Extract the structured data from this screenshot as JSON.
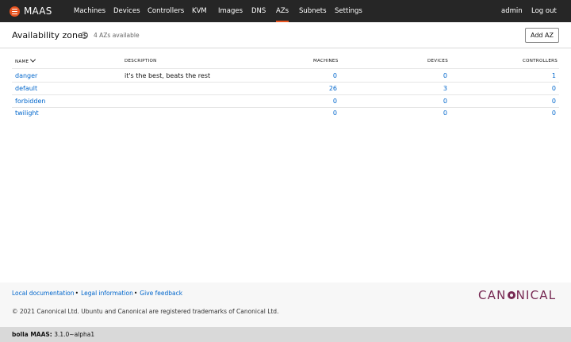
{
  "nav": {
    "logo": "MAAS",
    "items": [
      "Machines",
      "Devices",
      "Controllers",
      "KVM",
      "Images",
      "DNS",
      "AZs",
      "Subnets",
      "Settings"
    ],
    "active": "AZs",
    "user": "admin",
    "logout": "Log out"
  },
  "header": {
    "title": "Availability zones",
    "help_glyph": "?",
    "count": "4 AZs available",
    "add_button": "Add AZ"
  },
  "table": {
    "columns": [
      "NAME",
      "DESCRIPTION",
      "MACHINES",
      "DEVICES",
      "CONTROLLERS"
    ],
    "rows": [
      {
        "name": "danger",
        "description": "it's the best, beats the rest",
        "machines": "0",
        "devices": "0",
        "controllers": "1"
      },
      {
        "name": "default",
        "description": "",
        "machines": "26",
        "devices": "3",
        "controllers": "0"
      },
      {
        "name": "forbidden",
        "description": "",
        "machines": "0",
        "devices": "0",
        "controllers": "0"
      },
      {
        "name": "twilight",
        "description": "",
        "machines": "0",
        "devices": "0",
        "controllers": "0"
      }
    ]
  },
  "footer": {
    "links": [
      "Local documentation",
      "Legal information",
      "Give feedback"
    ],
    "separator": "•",
    "copyright": "© 2021 Canonical Ltd. Ubuntu and Canonical are registered trademarks of Canonical Ltd.",
    "brand_left": "CAN",
    "brand_right": "NICAL"
  },
  "status": {
    "host": "bolla MAAS:",
    "version": "3.1.0~alpha1"
  },
  "colors": {
    "nav_bg": "#262626",
    "accent": "#e95420",
    "link": "#0066cc",
    "brand": "#772953"
  }
}
